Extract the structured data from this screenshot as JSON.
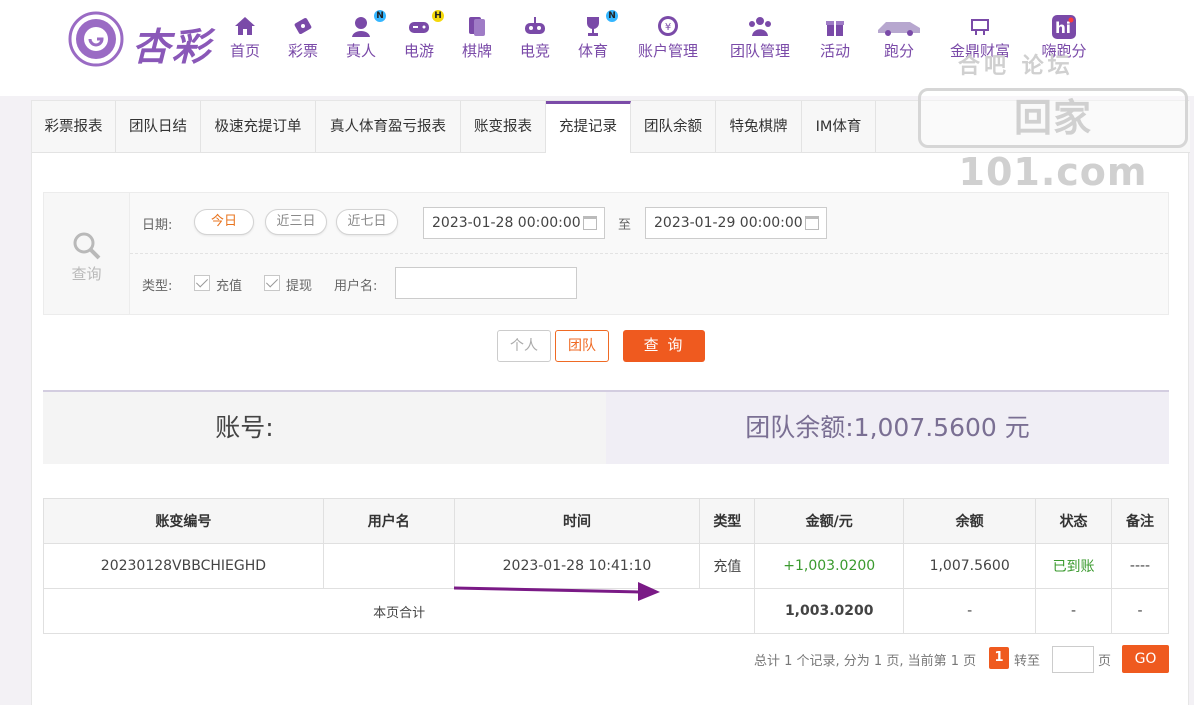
{
  "brand": {
    "name": "杏彩"
  },
  "nav": [
    {
      "label": "首页",
      "icon": "home-icon"
    },
    {
      "label": "彩票",
      "icon": "lottery-icon"
    },
    {
      "label": "真人",
      "icon": "live-dealer-icon",
      "badge": "N",
      "badge_color": "#35b6ff"
    },
    {
      "label": "电游",
      "icon": "gamepad-icon",
      "badge": "H",
      "badge_color": "#f5d90a"
    },
    {
      "label": "棋牌",
      "icon": "cards-icon"
    },
    {
      "label": "电竞",
      "icon": "esports-icon"
    },
    {
      "label": "体育",
      "icon": "trophy-icon",
      "badge": "N",
      "badge_color": "#35b6ff"
    },
    {
      "label": "账户管理",
      "icon": "yen-coin-icon"
    },
    {
      "label": "团队管理",
      "icon": "team-icon"
    },
    {
      "label": "活动",
      "icon": "gift-icon"
    },
    {
      "label": "跑分",
      "icon": "car-icon"
    },
    {
      "label": "金鼎财富",
      "icon": "wealth-icon"
    },
    {
      "label": "嗨跑分",
      "icon": "hi-icon"
    }
  ],
  "watermark": {
    "top": "合吧  论坛",
    "main": "回家101.com"
  },
  "tabs": [
    {
      "label": "彩票报表"
    },
    {
      "label": "团队日结"
    },
    {
      "label": "极速充提订单"
    },
    {
      "label": "真人体育盈亏报表"
    },
    {
      "label": "账变报表"
    },
    {
      "label": "充提记录",
      "active": true
    },
    {
      "label": "团队余额"
    },
    {
      "label": "特兔棋牌"
    },
    {
      "label": "IM体育"
    }
  ],
  "filter": {
    "query_label": "查询",
    "date_label": "日期:",
    "quick_ranges": [
      "今日",
      "近三日",
      "近七日"
    ],
    "start_date": "2023-01-28 00:00:00",
    "to_label": "至",
    "end_date": "2023-01-29 00:00:00",
    "type_label": "类型:",
    "types": [
      "充值",
      "提现"
    ],
    "username_label": "用户名:",
    "username_value": ""
  },
  "scope_buttons": {
    "personal": "个人",
    "team": "团队"
  },
  "search_button": "查 询",
  "summary": {
    "account_label": "账号:",
    "account_value": "",
    "balance_text": "团队余额:1,007.5600 元"
  },
  "table": {
    "headers": [
      "账变编号",
      "用户名",
      "时间",
      "类型",
      "金额/元",
      "余额",
      "状态",
      "备注"
    ],
    "rows": [
      {
        "id": "20230128VBBCHIEGHD",
        "user": "",
        "time": "2023-01-28 10:41:10",
        "type": "充值",
        "amount": "+1,003.0200",
        "balance": "1,007.5600",
        "status": "已到账",
        "note": "----"
      }
    ],
    "total": {
      "label": "本页合计",
      "amount": "1,003.0200",
      "balance": "-",
      "status": "-",
      "note": "-"
    }
  },
  "pager": {
    "text": "总计 1 个记录, 分为 1 页, 当前第 1 页",
    "current": "1",
    "goto_label": "转至",
    "page_unit": "页",
    "go": "GO"
  },
  "colors": {
    "brand_purple": "#7b4ba8",
    "accent_orange": "#ef6a24",
    "positive_green": "#3a9a2e",
    "arrow": "#7a1a86"
  }
}
